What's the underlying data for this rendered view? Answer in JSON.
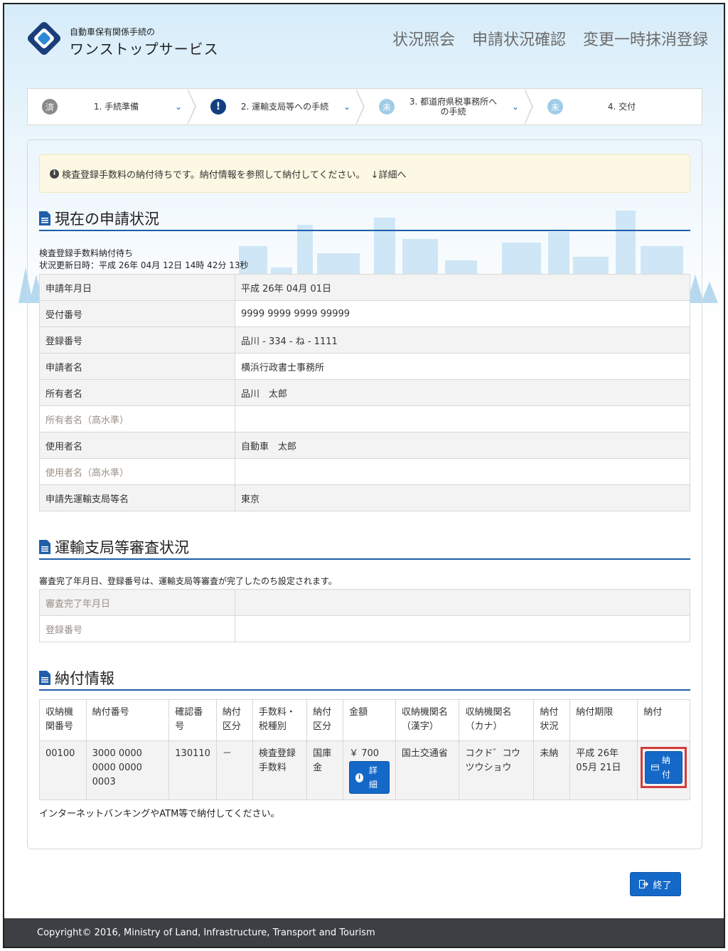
{
  "header": {
    "logo_sub": "自動車保有関係手続の",
    "logo_main": "ワンストップサービス",
    "nav": [
      "状況照会",
      "申請状況確認",
      "変更一時抹消登録"
    ]
  },
  "steps": [
    {
      "badge": "済",
      "label": "1. 手続準備",
      "chevron": "⌄"
    },
    {
      "badge": "!",
      "label": "2. 運輸支局等への手続",
      "chevron": "⌄"
    },
    {
      "badge": "未",
      "label": "3. 都道府県税事務所への手続",
      "chevron": "⌄"
    },
    {
      "badge": "未",
      "label": "4. 交付",
      "chevron": ""
    }
  ],
  "alert": {
    "text": "検査登録手数料の納付待ちです。納付情報を参照して納付してください。",
    "link": "詳細へ"
  },
  "current_status": {
    "title": "現在の申請状況",
    "status": "検査登録手数料納付待ち",
    "updated": "状況更新日時：平成 26年 04月 12日 14時 42分 13秒",
    "rows": [
      {
        "label": "申請年月日",
        "value": "平成 26年 04月 01日"
      },
      {
        "label": "受付番号",
        "value": "9999 9999 9999 99999"
      },
      {
        "label": "登録番号",
        "value": "品川 - 334 - ね - 1111"
      },
      {
        "label": "申請者名",
        "value": "横浜行政書士事務所"
      },
      {
        "label": "所有者名",
        "value": "品川　太郎"
      },
      {
        "label": "所有者名（高水準）",
        "value": ""
      },
      {
        "label": "使用者名",
        "value": "自動車　太郎"
      },
      {
        "label": "使用者名（高水準）",
        "value": ""
      },
      {
        "label": "申請先運輸支局等名",
        "value": "東京"
      }
    ]
  },
  "review": {
    "title": "運輸支局等審査状況",
    "note": "審査完了年月日、登録番号は、運輸支局等審査が完了したのち設定されます。",
    "rows": [
      {
        "label": "審査完了年月日",
        "value": ""
      },
      {
        "label": "登録番号",
        "value": ""
      }
    ]
  },
  "payment": {
    "title": "納付情報",
    "headers": [
      "収納機関番号",
      "納付番号",
      "確認番号",
      "納付区分",
      "手数料・税種別",
      "納付区分",
      "金額",
      "収納機関名（漢字）",
      "収納機関名（カナ）",
      "納付状況",
      "納付期限",
      "納付"
    ],
    "row": {
      "org_no": "00100",
      "pay_no": "3000 0000 0000 0000 0003",
      "confirm_no": "130110",
      "division": "－",
      "fee_type": "検査登録手数料",
      "pay_division": "国庫金",
      "amount": "￥ 700",
      "detail_btn": "詳細",
      "org_kanji": "国土交通省",
      "org_kana": "コクド゛コウツウショウ",
      "status": "未納",
      "deadline": "平成 26年 05月 21日",
      "pay_btn": "納付"
    },
    "note": "インターネットバンキングやATM等で納付してください。"
  },
  "end_button": "終了",
  "footer": "Copyright© 2016, Ministry of Land, Infrastructure, Transport and Tourism",
  "colors": {
    "accent": "#1468c8",
    "title_rule": "#1f5ea8",
    "alert_bg": "#fcf8e3",
    "highlight": "#d23c3c"
  },
  "icons": [
    "logo-diamond-icon",
    "info-icon",
    "arrow-down-icon",
    "document-icon",
    "card-icon",
    "exit-icon",
    "chevron-down-icon"
  ]
}
